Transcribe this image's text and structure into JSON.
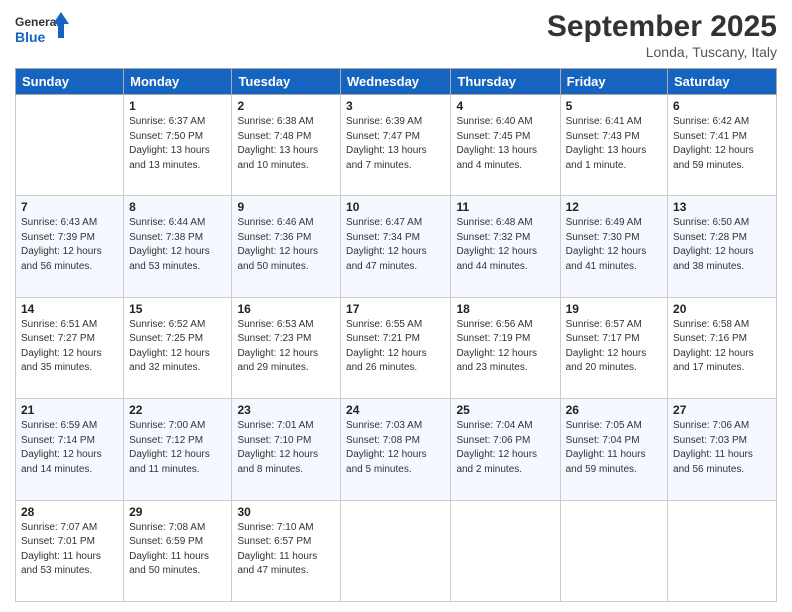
{
  "header": {
    "logo_general": "General",
    "logo_blue": "Blue",
    "month_title": "September 2025",
    "subtitle": "Londa, Tuscany, Italy"
  },
  "columns": [
    "Sunday",
    "Monday",
    "Tuesday",
    "Wednesday",
    "Thursday",
    "Friday",
    "Saturday"
  ],
  "weeks": [
    [
      {
        "day": "",
        "info": ""
      },
      {
        "day": "1",
        "info": "Sunrise: 6:37 AM\nSunset: 7:50 PM\nDaylight: 13 hours\nand 13 minutes."
      },
      {
        "day": "2",
        "info": "Sunrise: 6:38 AM\nSunset: 7:48 PM\nDaylight: 13 hours\nand 10 minutes."
      },
      {
        "day": "3",
        "info": "Sunrise: 6:39 AM\nSunset: 7:47 PM\nDaylight: 13 hours\nand 7 minutes."
      },
      {
        "day": "4",
        "info": "Sunrise: 6:40 AM\nSunset: 7:45 PM\nDaylight: 13 hours\nand 4 minutes."
      },
      {
        "day": "5",
        "info": "Sunrise: 6:41 AM\nSunset: 7:43 PM\nDaylight: 13 hours\nand 1 minute."
      },
      {
        "day": "6",
        "info": "Sunrise: 6:42 AM\nSunset: 7:41 PM\nDaylight: 12 hours\nand 59 minutes."
      }
    ],
    [
      {
        "day": "7",
        "info": "Sunrise: 6:43 AM\nSunset: 7:39 PM\nDaylight: 12 hours\nand 56 minutes."
      },
      {
        "day": "8",
        "info": "Sunrise: 6:44 AM\nSunset: 7:38 PM\nDaylight: 12 hours\nand 53 minutes."
      },
      {
        "day": "9",
        "info": "Sunrise: 6:46 AM\nSunset: 7:36 PM\nDaylight: 12 hours\nand 50 minutes."
      },
      {
        "day": "10",
        "info": "Sunrise: 6:47 AM\nSunset: 7:34 PM\nDaylight: 12 hours\nand 47 minutes."
      },
      {
        "day": "11",
        "info": "Sunrise: 6:48 AM\nSunset: 7:32 PM\nDaylight: 12 hours\nand 44 minutes."
      },
      {
        "day": "12",
        "info": "Sunrise: 6:49 AM\nSunset: 7:30 PM\nDaylight: 12 hours\nand 41 minutes."
      },
      {
        "day": "13",
        "info": "Sunrise: 6:50 AM\nSunset: 7:28 PM\nDaylight: 12 hours\nand 38 minutes."
      }
    ],
    [
      {
        "day": "14",
        "info": "Sunrise: 6:51 AM\nSunset: 7:27 PM\nDaylight: 12 hours\nand 35 minutes."
      },
      {
        "day": "15",
        "info": "Sunrise: 6:52 AM\nSunset: 7:25 PM\nDaylight: 12 hours\nand 32 minutes."
      },
      {
        "day": "16",
        "info": "Sunrise: 6:53 AM\nSunset: 7:23 PM\nDaylight: 12 hours\nand 29 minutes."
      },
      {
        "day": "17",
        "info": "Sunrise: 6:55 AM\nSunset: 7:21 PM\nDaylight: 12 hours\nand 26 minutes."
      },
      {
        "day": "18",
        "info": "Sunrise: 6:56 AM\nSunset: 7:19 PM\nDaylight: 12 hours\nand 23 minutes."
      },
      {
        "day": "19",
        "info": "Sunrise: 6:57 AM\nSunset: 7:17 PM\nDaylight: 12 hours\nand 20 minutes."
      },
      {
        "day": "20",
        "info": "Sunrise: 6:58 AM\nSunset: 7:16 PM\nDaylight: 12 hours\nand 17 minutes."
      }
    ],
    [
      {
        "day": "21",
        "info": "Sunrise: 6:59 AM\nSunset: 7:14 PM\nDaylight: 12 hours\nand 14 minutes."
      },
      {
        "day": "22",
        "info": "Sunrise: 7:00 AM\nSunset: 7:12 PM\nDaylight: 12 hours\nand 11 minutes."
      },
      {
        "day": "23",
        "info": "Sunrise: 7:01 AM\nSunset: 7:10 PM\nDaylight: 12 hours\nand 8 minutes."
      },
      {
        "day": "24",
        "info": "Sunrise: 7:03 AM\nSunset: 7:08 PM\nDaylight: 12 hours\nand 5 minutes."
      },
      {
        "day": "25",
        "info": "Sunrise: 7:04 AM\nSunset: 7:06 PM\nDaylight: 12 hours\nand 2 minutes."
      },
      {
        "day": "26",
        "info": "Sunrise: 7:05 AM\nSunset: 7:04 PM\nDaylight: 11 hours\nand 59 minutes."
      },
      {
        "day": "27",
        "info": "Sunrise: 7:06 AM\nSunset: 7:03 PM\nDaylight: 11 hours\nand 56 minutes."
      }
    ],
    [
      {
        "day": "28",
        "info": "Sunrise: 7:07 AM\nSunset: 7:01 PM\nDaylight: 11 hours\nand 53 minutes."
      },
      {
        "day": "29",
        "info": "Sunrise: 7:08 AM\nSunset: 6:59 PM\nDaylight: 11 hours\nand 50 minutes."
      },
      {
        "day": "30",
        "info": "Sunrise: 7:10 AM\nSunset: 6:57 PM\nDaylight: 11 hours\nand 47 minutes."
      },
      {
        "day": "",
        "info": ""
      },
      {
        "day": "",
        "info": ""
      },
      {
        "day": "",
        "info": ""
      },
      {
        "day": "",
        "info": ""
      }
    ]
  ]
}
